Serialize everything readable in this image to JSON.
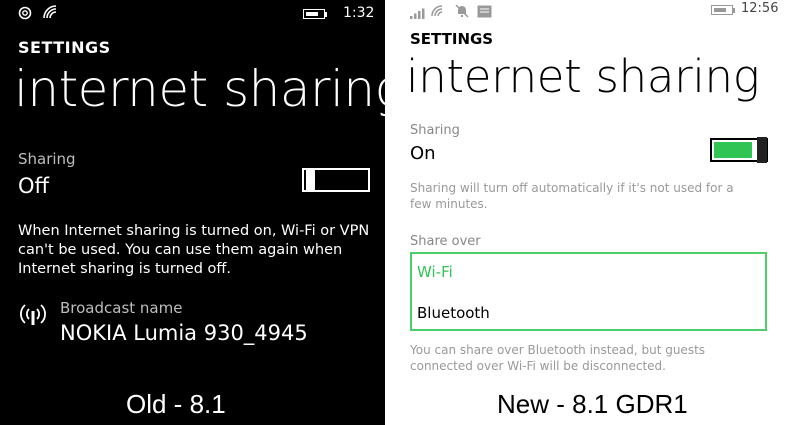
{
  "colors": {
    "accent_green": "#30c454",
    "box_green": "#4ccf6b",
    "left_bg": "#000000",
    "right_bg": "#ffffff"
  },
  "left": {
    "status": {
      "time": "1:32",
      "icons": [
        "sync-icon",
        "wifi-signal-icon",
        "battery-icon"
      ]
    },
    "settings_label": "SETTINGS",
    "title": "internet sharing",
    "sharing_label": "Sharing",
    "sharing_value": "Off",
    "toggle_state": "off",
    "note": "When Internet sharing is turned on, Wi-Fi or VPN can't be used. You can use them again when Internet sharing is turned off.",
    "broadcast_label": "Broadcast name",
    "broadcast_value": "NOKIA Lumia 930_4945",
    "caption": "Old - 8.1"
  },
  "right": {
    "status": {
      "time": "12:56",
      "icons": [
        "signal-bars-icon",
        "wifi-icon",
        "mute-icon",
        "message-icon",
        "battery-icon"
      ]
    },
    "settings_label": "SETTINGS",
    "title": "internet sharing",
    "sharing_label": "Sharing",
    "sharing_value": "On",
    "toggle_state": "on",
    "note": "Sharing will turn off automatically if it's not used for a few minutes.",
    "share_over_label": "Share over",
    "options": [
      "Wi-Fi",
      "Bluetooth"
    ],
    "selected_option": "Wi-Fi",
    "bottom_note": "You can share over Bluetooth instead, but guests connected over Wi-Fi will be disconnected.",
    "caption": "New - 8.1 GDR1"
  }
}
